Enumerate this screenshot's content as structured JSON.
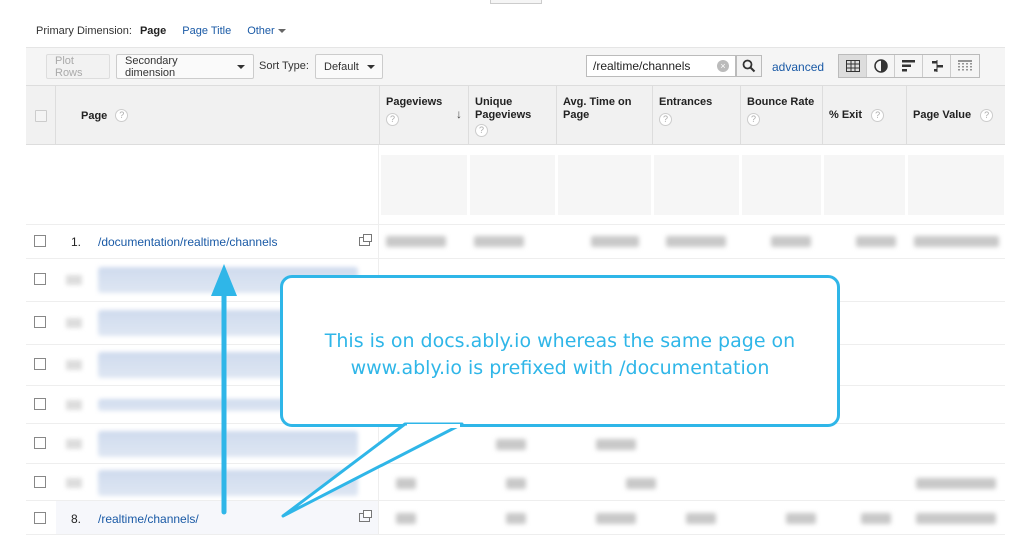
{
  "dimension_bar": {
    "label": "Primary Dimension:",
    "current": "Page",
    "link": "Page Title",
    "other": "Other"
  },
  "toolbar": {
    "plot_rows": "Plot Rows",
    "secondary_dimension": "Secondary dimension",
    "sort_type_label": "Sort Type:",
    "sort_type_value": "Default",
    "search_value": "/realtime/channels",
    "advanced": "advanced"
  },
  "table": {
    "columns": {
      "page": "Page",
      "pageviews": "Pageviews",
      "unique_pageviews": "Unique Pageviews",
      "avg_time": "Avg. Time on Page",
      "entrances": "Entrances",
      "bounce_rate": "Bounce Rate",
      "exit": "% Exit",
      "page_value": "Page Value"
    },
    "rows": [
      {
        "num": "1.",
        "page": "/documentation/realtime/channels"
      },
      {
        "num": "8.",
        "page": "/realtime/channels/"
      }
    ]
  },
  "annotation": {
    "text": "This is on docs.ably.io whereas the same page on www.ably.io is prefixed with /documentation",
    "color": "#2fb6e8"
  }
}
